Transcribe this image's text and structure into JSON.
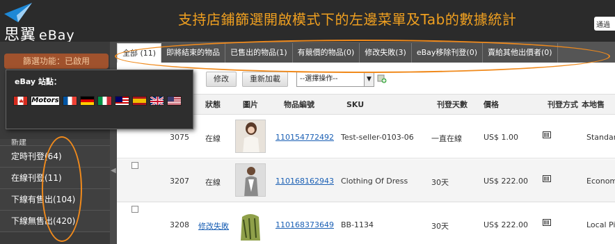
{
  "brand": {
    "name": "思翼",
    "suffix": "eBay"
  },
  "promo_text": "支持店鋪篩選開啟模式下的左邊菜單及Tab的數據統計",
  "notice_text": "通過",
  "sidebar": {
    "filter_button": "篩選功能：已啟用",
    "partial_item": "新建",
    "items": [
      {
        "label": "定時刊登(64)"
      },
      {
        "label": "在線刊登(11)"
      },
      {
        "label": "下線有售出(104)"
      },
      {
        "label": "下線無售出(420)"
      }
    ]
  },
  "site_popup": {
    "title": "eBay 站點：",
    "flags": [
      "canada",
      "motors",
      "france",
      "germany",
      "italy",
      "malaysia",
      "spain",
      "uk",
      "usa"
    ],
    "motors_label": "Motors"
  },
  "tabs": [
    {
      "label": "全部 (11)"
    },
    {
      "label": "即將結束的物品"
    },
    {
      "label": "已售出的物品(1)"
    },
    {
      "label": "有競價的物品(0)"
    },
    {
      "label": "修改失敗(3)"
    },
    {
      "label": "eBay移除刊登(0)"
    },
    {
      "label": "賣給其他出價者(0)"
    }
  ],
  "toolbar": {
    "edit": "修改",
    "reload": "重新加載",
    "select_value": "--選擇操作--"
  },
  "table": {
    "headers": [
      "狀態",
      "圖片",
      "物品編號",
      "SKU",
      "刊登天數",
      "價格",
      "刊登方式",
      "本地售"
    ],
    "rows": [
      {
        "id": "3075",
        "status": "在線",
        "item_no": "110154772492",
        "sku": "Test-seller-0103-06",
        "days": "一直在線",
        "price": "US$ 1.00",
        "type": "Standar"
      },
      {
        "id": "3207",
        "status": "在線",
        "item_no": "110168162943",
        "sku": "Clothing Of Dress",
        "days": "30天",
        "price": "US$ 222.00",
        "type": "Econom"
      },
      {
        "id": "3208",
        "status": "修改失敗",
        "item_no": "110168373649",
        "sku": "BB-1134",
        "days": "30天",
        "price": "US$ 222.00",
        "type": "Local Pi"
      }
    ]
  },
  "colors": {
    "accent": "#f08a1c",
    "link": "#1a5fb4",
    "dark": "#2b2b2b"
  }
}
